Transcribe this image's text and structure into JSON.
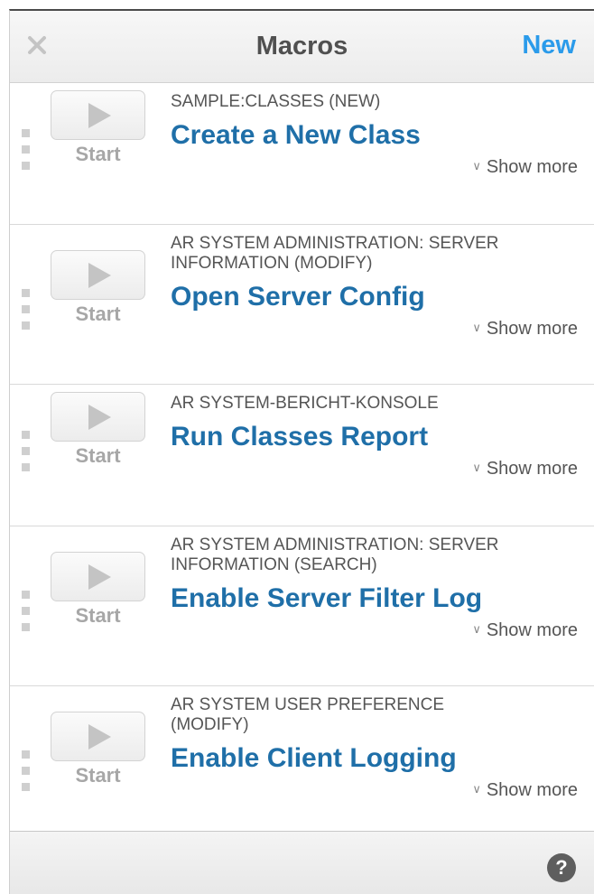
{
  "header": {
    "title": "Macros",
    "close_icon": "close-icon",
    "new_label": "New"
  },
  "macros": [
    {
      "category": "SAMPLE:CLASSES (NEW)",
      "name": "Create a New Class",
      "start_label": "Start",
      "show_more": "Show more"
    },
    {
      "category": "AR SYSTEM ADMINISTRATION: SERVER INFORMATION (MODIFY)",
      "name": "Open Server Config",
      "start_label": "Start",
      "show_more": "Show more"
    },
    {
      "category": "AR SYSTEM-BERICHT-KONSOLE",
      "name": "Run Classes Report",
      "start_label": "Start",
      "show_more": "Show more"
    },
    {
      "category": "AR SYSTEM ADMINISTRATION: SERVER INFORMATION (SEARCH)",
      "name": "Enable Server Filter Log",
      "start_label": "Start",
      "show_more": "Show more"
    },
    {
      "category": "AR SYSTEM USER PREFERENCE (MODIFY)",
      "name": "Enable Client Logging",
      "start_label": "Start",
      "show_more": "Show more"
    }
  ],
  "footer": {
    "help_label": "?",
    "help_icon": "help-icon"
  },
  "colors": {
    "accent": "#2b9bea",
    "macro_name": "#1f6fa8",
    "title": "#505050"
  }
}
